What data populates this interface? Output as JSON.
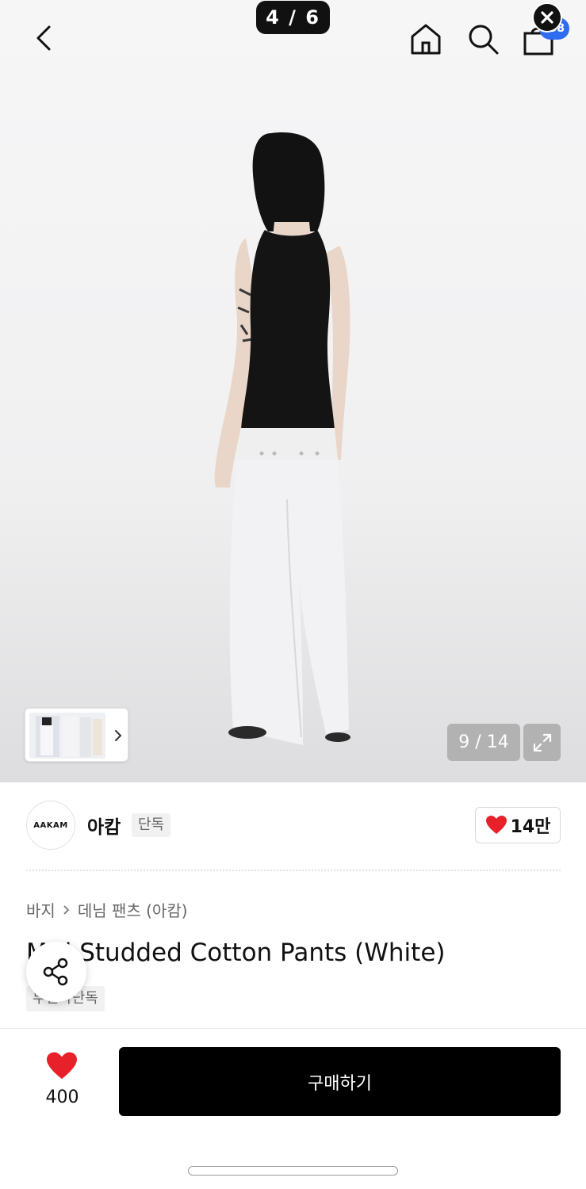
{
  "viewer": {
    "page_indicator": "4 / 6"
  },
  "header": {
    "back": "chevron-left-icon",
    "home": "home-icon",
    "search": "search-icon",
    "cart": "shopping-bag-icon",
    "cart_badge": "58",
    "close": "close-icon"
  },
  "gallery": {
    "counter": "9 / 14",
    "expand": "expand-icon",
    "thumb_arrow": "chevron-right-icon"
  },
  "brand": {
    "logo_text": "AAKAM",
    "name": "아캄",
    "tag": "단독",
    "like_count": "14만"
  },
  "breadcrumb": [
    "바지",
    "데님 팬츠 (아캄)"
  ],
  "product": {
    "title": "M  ti Studded Cotton Pants (White)",
    "exclusive_tag": "무신사단독"
  },
  "bottom_bar": {
    "like_count": "400",
    "buy_label": "구매하기"
  },
  "colors": {
    "accent_red": "#e8202a",
    "badge_blue": "#2f6cf0",
    "buy_button": "#000000"
  }
}
